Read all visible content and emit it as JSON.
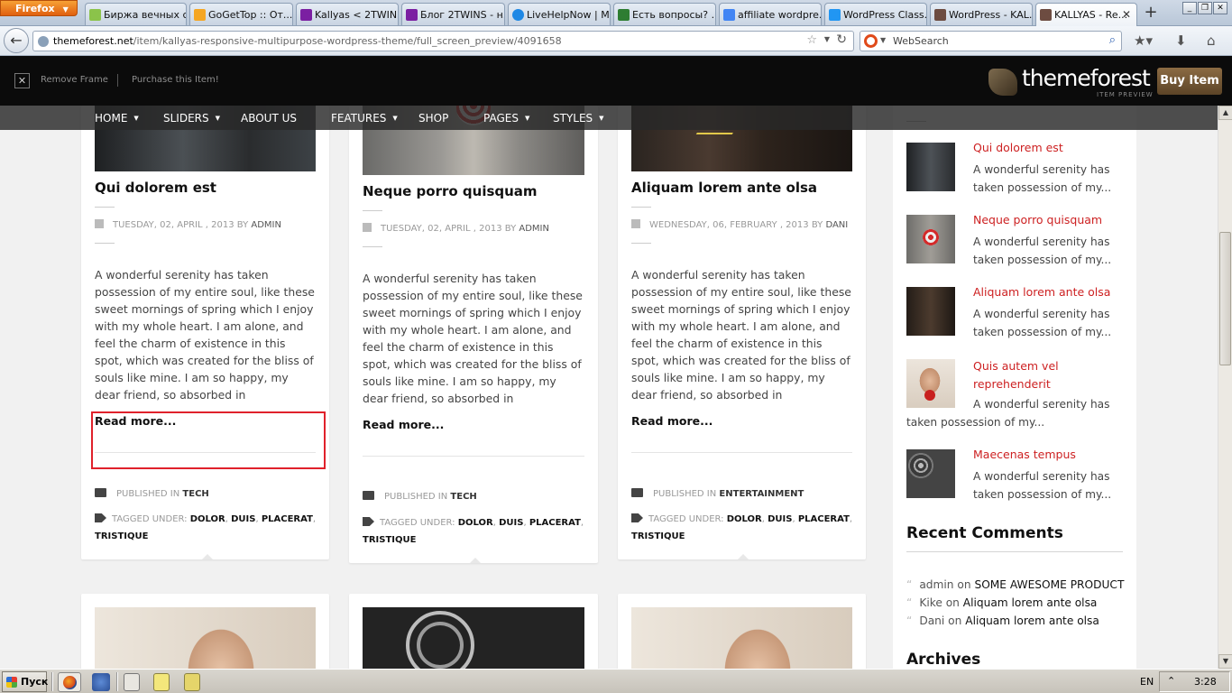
{
  "browser": {
    "menu_label": "Firefox",
    "tabs": [
      {
        "label": "Биржа вечных с...",
        "color": "#8bc34a"
      },
      {
        "label": "GoGetTop :: От...",
        "color": "#f5a623"
      },
      {
        "label": "Kallyas < 2TWIN...",
        "color": "#7b1fa2"
      },
      {
        "label": "Блог 2TWINS - н...",
        "color": "#7b1fa2"
      },
      {
        "label": "LiveHelpNow | M...",
        "color": "#1e88e5"
      },
      {
        "label": "Есть вопросы? ...",
        "color": "#2e7d32"
      },
      {
        "label": "affiliate wordpre...",
        "color": "#4285f4"
      },
      {
        "label": "WordPress Class...",
        "color": "#2196f3"
      },
      {
        "label": "WordPress - KAL...",
        "color": "#6d4c41"
      },
      {
        "label": "KALLYAS - Re...",
        "color": "#6d4c41"
      }
    ],
    "url_domain": "themeforest.net",
    "url_path": "/item/kallyas-responsive-multipurpose-wordpress-theme/full_screen_preview/4091658",
    "search_placeholder": "WebSearch"
  },
  "preview_bar": {
    "remove_frame": "Remove Frame",
    "purchase": "Purchase this Item!",
    "logo_text": "themeforest",
    "logo_sub": "ITEM PREVIEW",
    "buy_label": "Buy Item"
  },
  "menu": [
    {
      "label": "HOME",
      "dropdown": true
    },
    {
      "label": "SLIDERS",
      "dropdown": true
    },
    {
      "label": "ABOUT US",
      "dropdown": false
    },
    {
      "label": "FEATURES",
      "dropdown": true
    },
    {
      "label": "SHOP",
      "dropdown": false
    },
    {
      "label": "PAGES",
      "dropdown": true
    },
    {
      "label": "STYLES",
      "dropdown": true
    }
  ],
  "posts": [
    {
      "title": "Qui dolorem est",
      "date": "TUESDAY, 02, APRIL , 2013",
      "by": "BY",
      "author": "ADMIN",
      "excerpt": "A wonderful serenity has taken possession of my entire soul, like these sweet mornings of spring which I enjoy with my whole heart. I am alone, and feel the charm of existence in this spot, which was created for the bliss of souls like mine. I am so happy, my dear friend, so absorbed in",
      "read_more": "Read more...",
      "published_label": "PUBLISHED IN",
      "category": "TECH",
      "tagged_label": "TAGGED UNDER:",
      "tags": [
        "DOLOR",
        "DUIS",
        "PLACERAT",
        "TRISTIQUE"
      ]
    },
    {
      "title": "Neque porro quisquam",
      "date": "TUESDAY, 02, APRIL , 2013",
      "by": "BY",
      "author": "ADMIN",
      "excerpt": "A wonderful serenity has taken possession of my entire soul, like these sweet mornings of spring which I enjoy with my whole heart. I am alone, and feel the charm of existence in this spot, which was created for the bliss of souls like mine. I am so happy, my dear friend, so absorbed in",
      "read_more": "Read more...",
      "published_label": "PUBLISHED IN",
      "category": "TECH",
      "tagged_label": "TAGGED UNDER:",
      "tags": [
        "DOLOR",
        "DUIS",
        "PLACERAT",
        "TRISTIQUE"
      ]
    },
    {
      "title": "Aliquam lorem ante olsa",
      "date": "WEDNESDAY, 06, FEBRUARY , 2013",
      "by": "BY",
      "author": "DANI",
      "excerpt": "A wonderful serenity has taken possession of my entire soul, like these sweet mornings of spring which I enjoy with my whole heart. I am alone, and feel the charm of existence in this spot, which was created for the bliss of souls like mine. I am so happy, my dear friend, so absorbed in",
      "read_more": "Read more...",
      "published_label": "PUBLISHED IN",
      "category": "ENTERTAINMENT",
      "tagged_label": "TAGGED UNDER:",
      "tags": [
        "DOLOR",
        "DUIS",
        "PLACERAT",
        "TRISTIQUE"
      ]
    }
  ],
  "sidebar": {
    "popular": [
      {
        "title": "Qui dolorem est",
        "excerpt": "A wonderful serenity has taken possession of my..."
      },
      {
        "title": "Neque porro quisquam",
        "excerpt": "A wonderful serenity has taken possession of my..."
      },
      {
        "title": "Aliquam lorem ante olsa",
        "excerpt": "A wonderful serenity has taken possession of my..."
      },
      {
        "title": "Quis autem vel reprehenderit",
        "excerpt": "A wonderful serenity has taken possession of my..."
      },
      {
        "title": "Maecenas tempus",
        "excerpt": "A wonderful serenity has taken possession of my..."
      }
    ],
    "recent_comments_title": "Recent Comments",
    "recent_comments": [
      {
        "author": "admin",
        "on": "on",
        "post": "SOME AWESOME PRODUCT"
      },
      {
        "author": "Kike",
        "on": "on",
        "post": "Aliquam lorem ante olsa"
      },
      {
        "author": "Dani",
        "on": "on",
        "post": "Aliquam lorem ante olsa"
      }
    ],
    "archives_title": "Archives"
  },
  "taskbar": {
    "start_label": "Пуск",
    "language": "EN",
    "time": "3:28"
  },
  "colors": {
    "accent_red": "#cd2122",
    "buy_brown": "#7a5c38",
    "highlight_box": "#e0212b"
  }
}
